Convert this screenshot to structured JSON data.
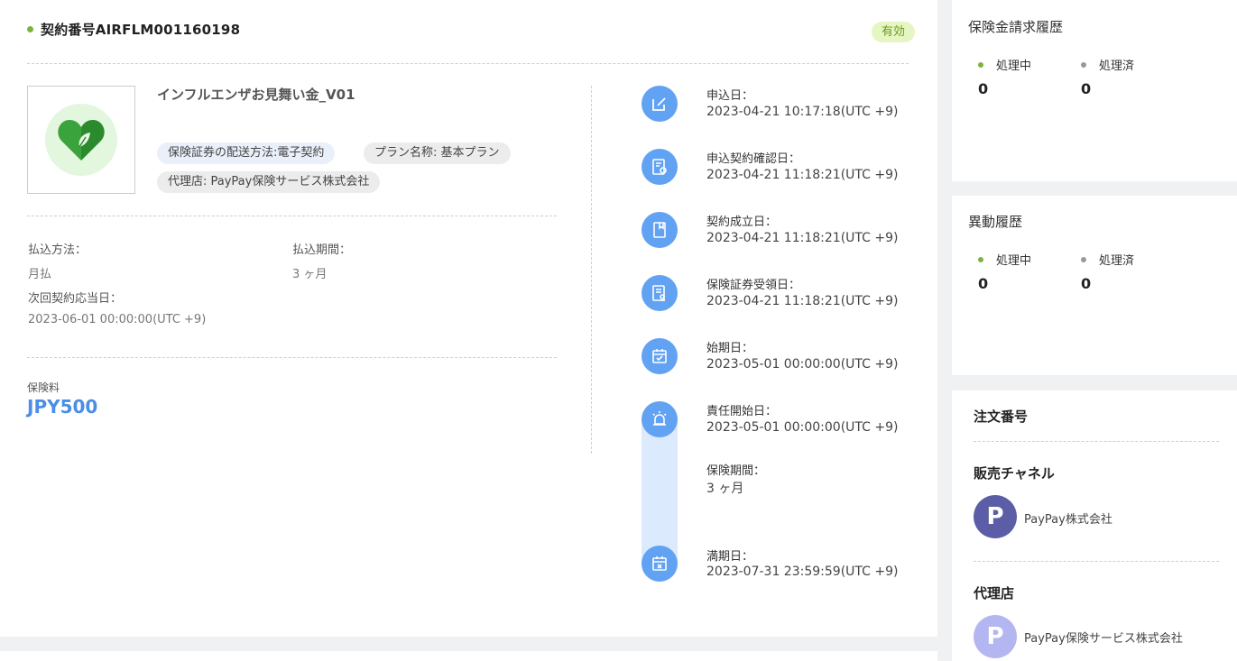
{
  "contract": {
    "number": "契約番号AIRFLM001160198",
    "status": "有効",
    "product_name": "インフルエンザお見舞い金_V01",
    "tags": [
      "保険証券の配送方法:電子契約",
      "プラン名称: 基本プラン",
      "代理店: PayPay保険サービス株式会社"
    ],
    "payment_method_label": "払込方法：",
    "payment_method_value": "月払",
    "payment_period_label": "払込期間：",
    "payment_period_value": "3 ヶ月",
    "next_date_label": "次回契約応当日：",
    "next_date_value": "2023-06-01 00:00:00(UTC +9)",
    "premium_label": "保険料",
    "premium_value": "JPY500"
  },
  "timeline": [
    {
      "label": "申込日：",
      "value": "2023-04-21 10:17:18(UTC +9)",
      "icon": "edit-icon"
    },
    {
      "label": "申込契約確認日：",
      "value": "2023-04-21 11:18:21(UTC +9)",
      "icon": "document-check-icon"
    },
    {
      "label": "契約成立日：",
      "value": "2023-04-21 11:18:21(UTC +9)",
      "icon": "bookmark-icon"
    },
    {
      "label": "保険証券受領日：",
      "value": "2023-04-21 11:18:21(UTC +9)",
      "icon": "certificate-icon"
    },
    {
      "label": "始期日：",
      "value": "2023-05-01 00:00:00(UTC +9)",
      "icon": "calendar-check-icon"
    },
    {
      "label": "責任開始日：",
      "value": "2023-05-01 00:00:00(UTC +9)",
      "icon": "alarm-icon"
    },
    {
      "label": "保険期間：",
      "value": "3 ヶ月",
      "icon": ""
    },
    {
      "label": "満期日：",
      "value": "2023-07-31 23:59:59(UTC +9)",
      "icon": "calendar-x-icon"
    }
  ],
  "claims": {
    "title": "保険金請求履歴",
    "processing_label": "処理中",
    "processing_count": "0",
    "processed_label": "処理済",
    "processed_count": "0"
  },
  "changes": {
    "title": "異動履歴",
    "processing_label": "処理中",
    "processing_count": "0",
    "processed_label": "処理済",
    "processed_count": "0"
  },
  "order": {
    "order_no_title": "注文番号",
    "channel_title": "販売チャネル",
    "channel_avatar": "P",
    "channel_name": "PayPay株式会社",
    "agency_title": "代理店",
    "agency_avatar": "P",
    "agency_name": "PayPay保険サービス株式会社"
  },
  "colors": {
    "accent_blue": "#4a8ee6",
    "status_green": "#7cb342",
    "timeline_icon": "#62a2f3",
    "avatar_dark": "#5b5ea6",
    "avatar_light": "#b3b6f0"
  }
}
